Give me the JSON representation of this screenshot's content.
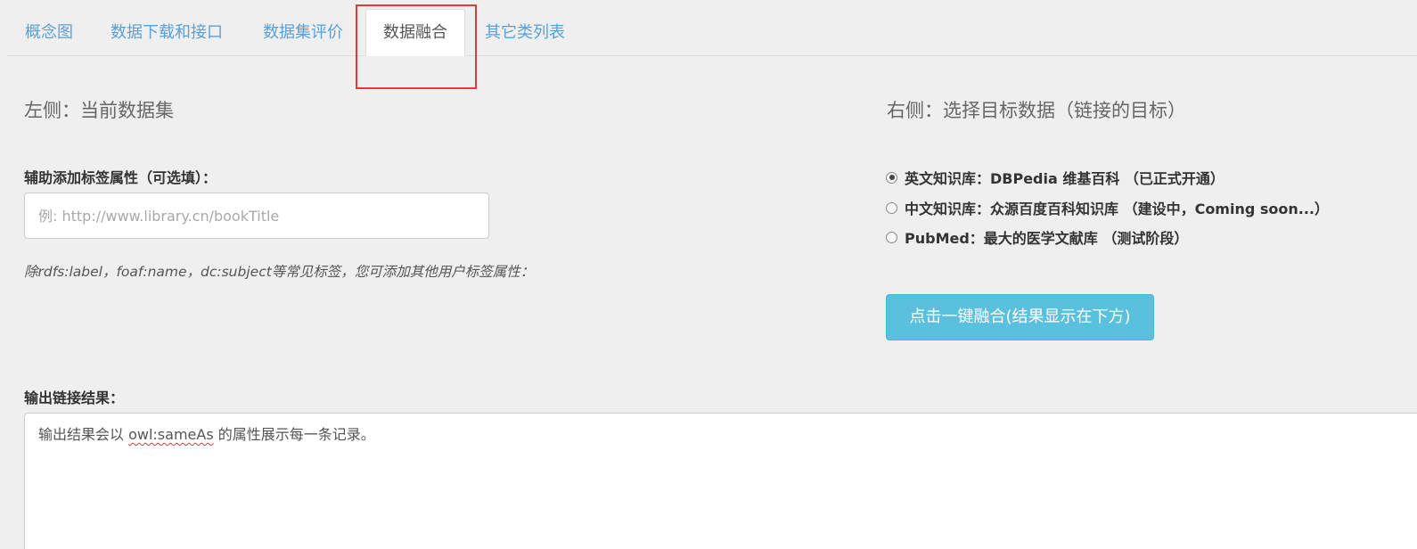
{
  "tabs": [
    {
      "label": "概念图"
    },
    {
      "label": "数据下载和接口"
    },
    {
      "label": "数据集评价"
    },
    {
      "label": "数据融合",
      "active": true
    },
    {
      "label": "其它类列表"
    }
  ],
  "left": {
    "title": "左侧：当前数据集",
    "label_field_title": "辅助添加标签属性（可选填）：",
    "label_input_placeholder": "例: http://www.library.cn/bookTitle",
    "label_input_value": "",
    "help_text": "除rdfs:label，foaf:name，dc:subject等常见标签，您可添加其他用户标签属性："
  },
  "right": {
    "title": "右侧：选择目标数据（链接的目标）",
    "options": [
      {
        "label": "英文知识库：DBPedia 维基百科 （已正式开通）",
        "checked": true
      },
      {
        "label": "中文知识库：众源百度百科知识库 （建设中，Coming soon...）",
        "checked": false
      },
      {
        "label": "PubMed：最大的医学文献库 （测试阶段）",
        "checked": false
      }
    ],
    "fuse_button_label": "点击一键融合(结果显示在下方)"
  },
  "output": {
    "title": "输出链接结果：",
    "text_before": "输出结果会以 ",
    "text_keyword": "owl:sameAs",
    "text_after": " 的属性展示每一条记录。"
  },
  "colors": {
    "tab_link": "#5aa0d8",
    "highlight_border": "#e03a3a",
    "button_bg": "#5bc0de",
    "page_bg": "#efefef"
  }
}
